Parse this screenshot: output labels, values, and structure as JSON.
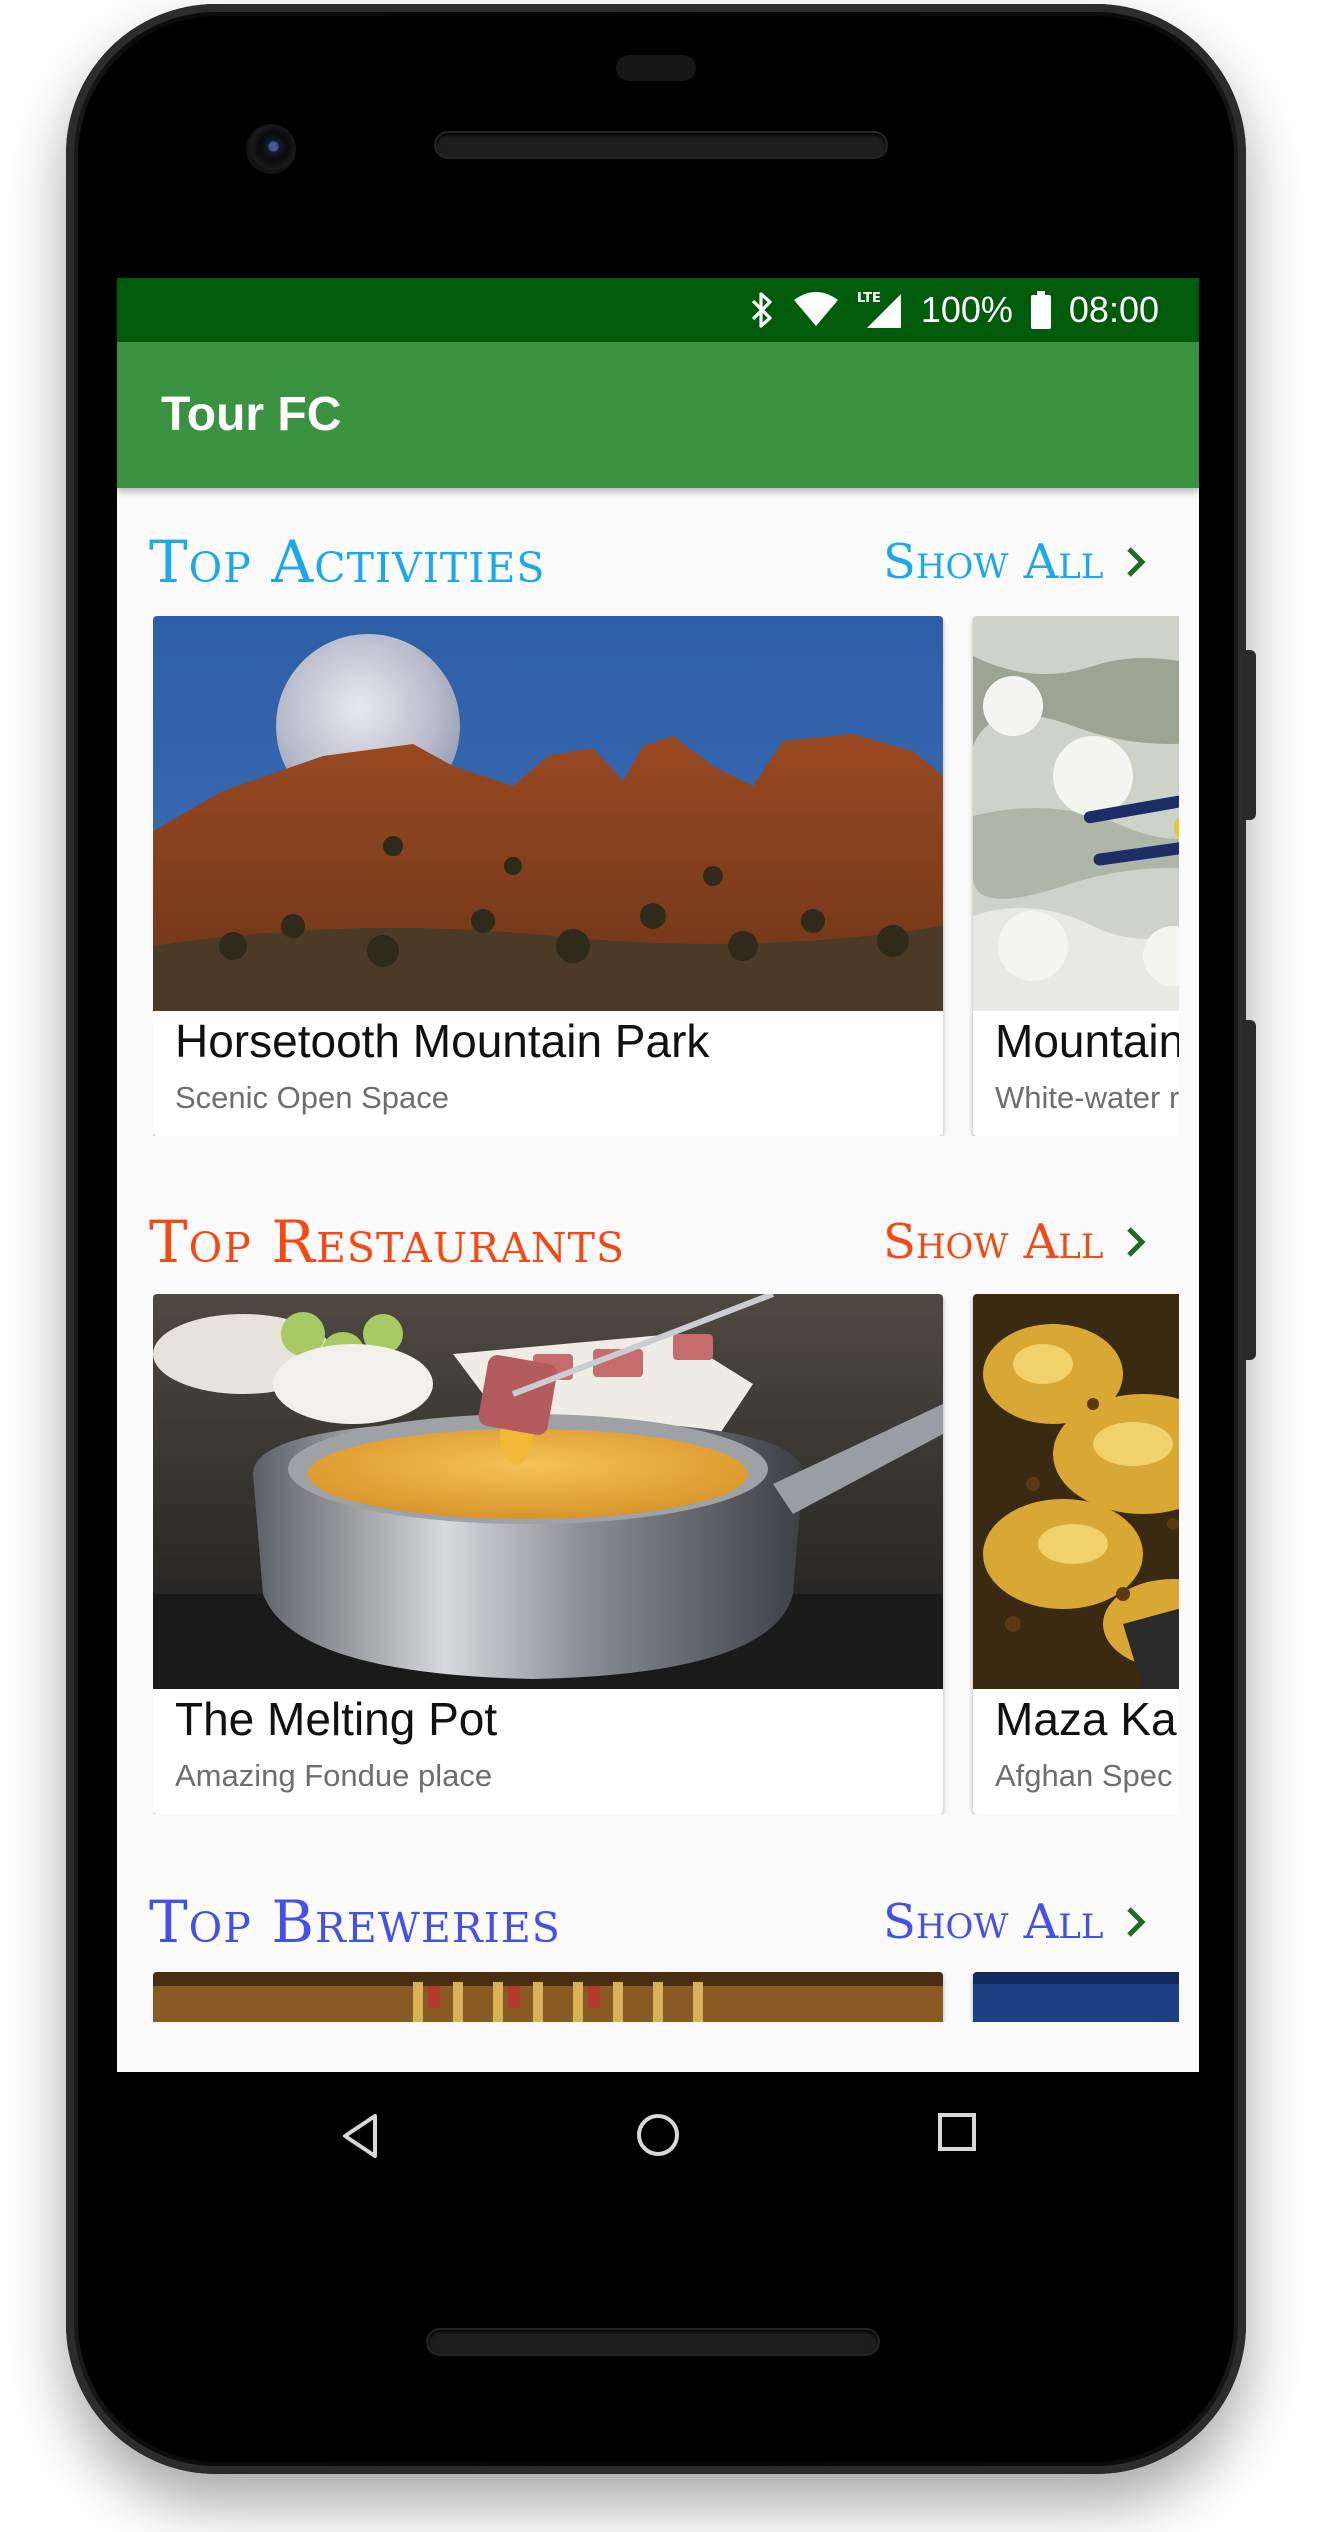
{
  "status_bar": {
    "battery": "100%",
    "time": "08:00",
    "network": "LTE",
    "icons": [
      "bluetooth-icon",
      "wifi-icon",
      "lte-signal-icon",
      "battery-icon"
    ]
  },
  "app_bar": {
    "title": "Tour FC",
    "color": "#3a9241",
    "status_color": "#005b0a"
  },
  "sections": [
    {
      "title": "Top Activities",
      "color": "#1ea8ea",
      "show_all": "Show All",
      "cards": [
        {
          "title": "Horsetooth Mountain Park",
          "subtitle": "Scenic Open Space",
          "image": "horsetooth-rock-moon"
        },
        {
          "title": "Mountain",
          "subtitle": "White-water r",
          "image": "whitewater-kayak"
        }
      ]
    },
    {
      "title": "Top Restaurants",
      "color": "#f24a17",
      "show_all": "Show All",
      "cards": [
        {
          "title": "The Melting Pot",
          "subtitle": "Amazing Fondue place",
          "image": "fondue-pot"
        },
        {
          "title": "Maza Ka",
          "subtitle": "Afghan Spec",
          "image": "grilled-dish"
        }
      ]
    },
    {
      "title": "Top Breweries",
      "color": "#4650e6",
      "show_all": "Show All",
      "cards": [
        {
          "image": "brewery-taps"
        },
        {
          "image": "night-sky"
        }
      ]
    }
  ],
  "chevron_color": "#1e6b23",
  "nav": {
    "buttons": [
      "back-icon",
      "home-icon",
      "recents-icon"
    ]
  }
}
